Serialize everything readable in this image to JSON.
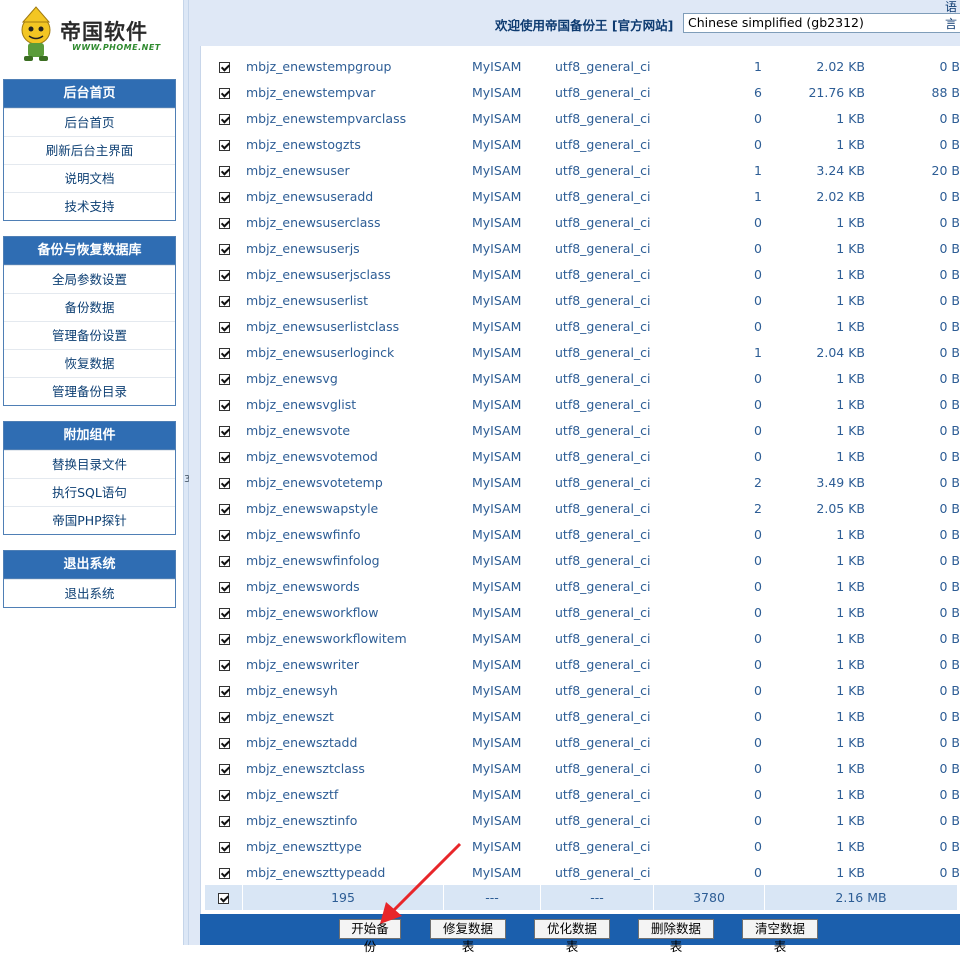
{
  "logo": {
    "title": "帝国软件",
    "url_text": "WWW.PHOME.NET"
  },
  "menus": [
    {
      "title": "后台首页",
      "items": [
        "后台首页",
        "刷新后台主界面",
        "说明文档",
        "技术支持"
      ]
    },
    {
      "title": "备份与恢复数据库",
      "items": [
        "全局参数设置",
        "备份数据",
        "管理备份设置",
        "恢复数据",
        "管理备份目录"
      ]
    },
    {
      "title": "附加组件",
      "items": [
        "替换目录文件",
        "执行SQL语句",
        "帝国PHP探针"
      ]
    },
    {
      "title": "退出系统",
      "items": [
        "退出系统"
      ]
    }
  ],
  "divider_mark": "3",
  "header": {
    "welcome": "欢迎使用帝国备份王 [官方网站]",
    "lang_partial": "语言",
    "language_selected": "Chinese simplified (gb2312)"
  },
  "tables": [
    {
      "name": "mbjz_enewstempgroup",
      "engine": "MyISAM",
      "collation": "utf8_general_ci",
      "rows": "1",
      "size": "2.02 KB",
      "free": "0 B"
    },
    {
      "name": "mbjz_enewstempvar",
      "engine": "MyISAM",
      "collation": "utf8_general_ci",
      "rows": "6",
      "size": "21.76 KB",
      "free": "88 B"
    },
    {
      "name": "mbjz_enewstempvarclass",
      "engine": "MyISAM",
      "collation": "utf8_general_ci",
      "rows": "0",
      "size": "1 KB",
      "free": "0 B"
    },
    {
      "name": "mbjz_enewstogzts",
      "engine": "MyISAM",
      "collation": "utf8_general_ci",
      "rows": "0",
      "size": "1 KB",
      "free": "0 B"
    },
    {
      "name": "mbjz_enewsuser",
      "engine": "MyISAM",
      "collation": "utf8_general_ci",
      "rows": "1",
      "size": "3.24 KB",
      "free": "20 B"
    },
    {
      "name": "mbjz_enewsuseradd",
      "engine": "MyISAM",
      "collation": "utf8_general_ci",
      "rows": "1",
      "size": "2.02 KB",
      "free": "0 B"
    },
    {
      "name": "mbjz_enewsuserclass",
      "engine": "MyISAM",
      "collation": "utf8_general_ci",
      "rows": "0",
      "size": "1 KB",
      "free": "0 B"
    },
    {
      "name": "mbjz_enewsuserjs",
      "engine": "MyISAM",
      "collation": "utf8_general_ci",
      "rows": "0",
      "size": "1 KB",
      "free": "0 B"
    },
    {
      "name": "mbjz_enewsuserjsclass",
      "engine": "MyISAM",
      "collation": "utf8_general_ci",
      "rows": "0",
      "size": "1 KB",
      "free": "0 B"
    },
    {
      "name": "mbjz_enewsuserlist",
      "engine": "MyISAM",
      "collation": "utf8_general_ci",
      "rows": "0",
      "size": "1 KB",
      "free": "0 B"
    },
    {
      "name": "mbjz_enewsuserlistclass",
      "engine": "MyISAM",
      "collation": "utf8_general_ci",
      "rows": "0",
      "size": "1 KB",
      "free": "0 B"
    },
    {
      "name": "mbjz_enewsuserloginck",
      "engine": "MyISAM",
      "collation": "utf8_general_ci",
      "rows": "1",
      "size": "2.04 KB",
      "free": "0 B"
    },
    {
      "name": "mbjz_enewsvg",
      "engine": "MyISAM",
      "collation": "utf8_general_ci",
      "rows": "0",
      "size": "1 KB",
      "free": "0 B"
    },
    {
      "name": "mbjz_enewsvglist",
      "engine": "MyISAM",
      "collation": "utf8_general_ci",
      "rows": "0",
      "size": "1 KB",
      "free": "0 B"
    },
    {
      "name": "mbjz_enewsvote",
      "engine": "MyISAM",
      "collation": "utf8_general_ci",
      "rows": "0",
      "size": "1 KB",
      "free": "0 B"
    },
    {
      "name": "mbjz_enewsvotemod",
      "engine": "MyISAM",
      "collation": "utf8_general_ci",
      "rows": "0",
      "size": "1 KB",
      "free": "0 B"
    },
    {
      "name": "mbjz_enewsvotetemp",
      "engine": "MyISAM",
      "collation": "utf8_general_ci",
      "rows": "2",
      "size": "3.49 KB",
      "free": "0 B"
    },
    {
      "name": "mbjz_enewswapstyle",
      "engine": "MyISAM",
      "collation": "utf8_general_ci",
      "rows": "2",
      "size": "2.05 KB",
      "free": "0 B"
    },
    {
      "name": "mbjz_enewswfinfo",
      "engine": "MyISAM",
      "collation": "utf8_general_ci",
      "rows": "0",
      "size": "1 KB",
      "free": "0 B"
    },
    {
      "name": "mbjz_enewswfinfolog",
      "engine": "MyISAM",
      "collation": "utf8_general_ci",
      "rows": "0",
      "size": "1 KB",
      "free": "0 B"
    },
    {
      "name": "mbjz_enewswords",
      "engine": "MyISAM",
      "collation": "utf8_general_ci",
      "rows": "0",
      "size": "1 KB",
      "free": "0 B"
    },
    {
      "name": "mbjz_enewsworkflow",
      "engine": "MyISAM",
      "collation": "utf8_general_ci",
      "rows": "0",
      "size": "1 KB",
      "free": "0 B"
    },
    {
      "name": "mbjz_enewsworkflowitem",
      "engine": "MyISAM",
      "collation": "utf8_general_ci",
      "rows": "0",
      "size": "1 KB",
      "free": "0 B"
    },
    {
      "name": "mbjz_enewswriter",
      "engine": "MyISAM",
      "collation": "utf8_general_ci",
      "rows": "0",
      "size": "1 KB",
      "free": "0 B"
    },
    {
      "name": "mbjz_enewsyh",
      "engine": "MyISAM",
      "collation": "utf8_general_ci",
      "rows": "0",
      "size": "1 KB",
      "free": "0 B"
    },
    {
      "name": "mbjz_enewszt",
      "engine": "MyISAM",
      "collation": "utf8_general_ci",
      "rows": "0",
      "size": "1 KB",
      "free": "0 B"
    },
    {
      "name": "mbjz_enewsztadd",
      "engine": "MyISAM",
      "collation": "utf8_general_ci",
      "rows": "0",
      "size": "1 KB",
      "free": "0 B"
    },
    {
      "name": "mbjz_enewsztclass",
      "engine": "MyISAM",
      "collation": "utf8_general_ci",
      "rows": "0",
      "size": "1 KB",
      "free": "0 B"
    },
    {
      "name": "mbjz_enewsztf",
      "engine": "MyISAM",
      "collation": "utf8_general_ci",
      "rows": "0",
      "size": "1 KB",
      "free": "0 B"
    },
    {
      "name": "mbjz_enewsztinfo",
      "engine": "MyISAM",
      "collation": "utf8_general_ci",
      "rows": "0",
      "size": "1 KB",
      "free": "0 B"
    },
    {
      "name": "mbjz_enewszttype",
      "engine": "MyISAM",
      "collation": "utf8_general_ci",
      "rows": "0",
      "size": "1 KB",
      "free": "0 B"
    },
    {
      "name": "mbjz_enewszttypeadd",
      "engine": "MyISAM",
      "collation": "utf8_general_ci",
      "rows": "0",
      "size": "1 KB",
      "free": "0 B"
    }
  ],
  "summary": {
    "table_count": "195",
    "engine": "---",
    "collation": "---",
    "total_rows": "3780",
    "total_size": "2.16 MB"
  },
  "buttons": [
    "开始备份",
    "修复数据表",
    "优化数据表",
    "删除数据表",
    "清空数据表"
  ],
  "colors": {
    "menu_header": "#2f6db3",
    "button_bar": "#1b5fad",
    "summary_row": "#d9e6f5",
    "arrow": "#e8262a"
  }
}
